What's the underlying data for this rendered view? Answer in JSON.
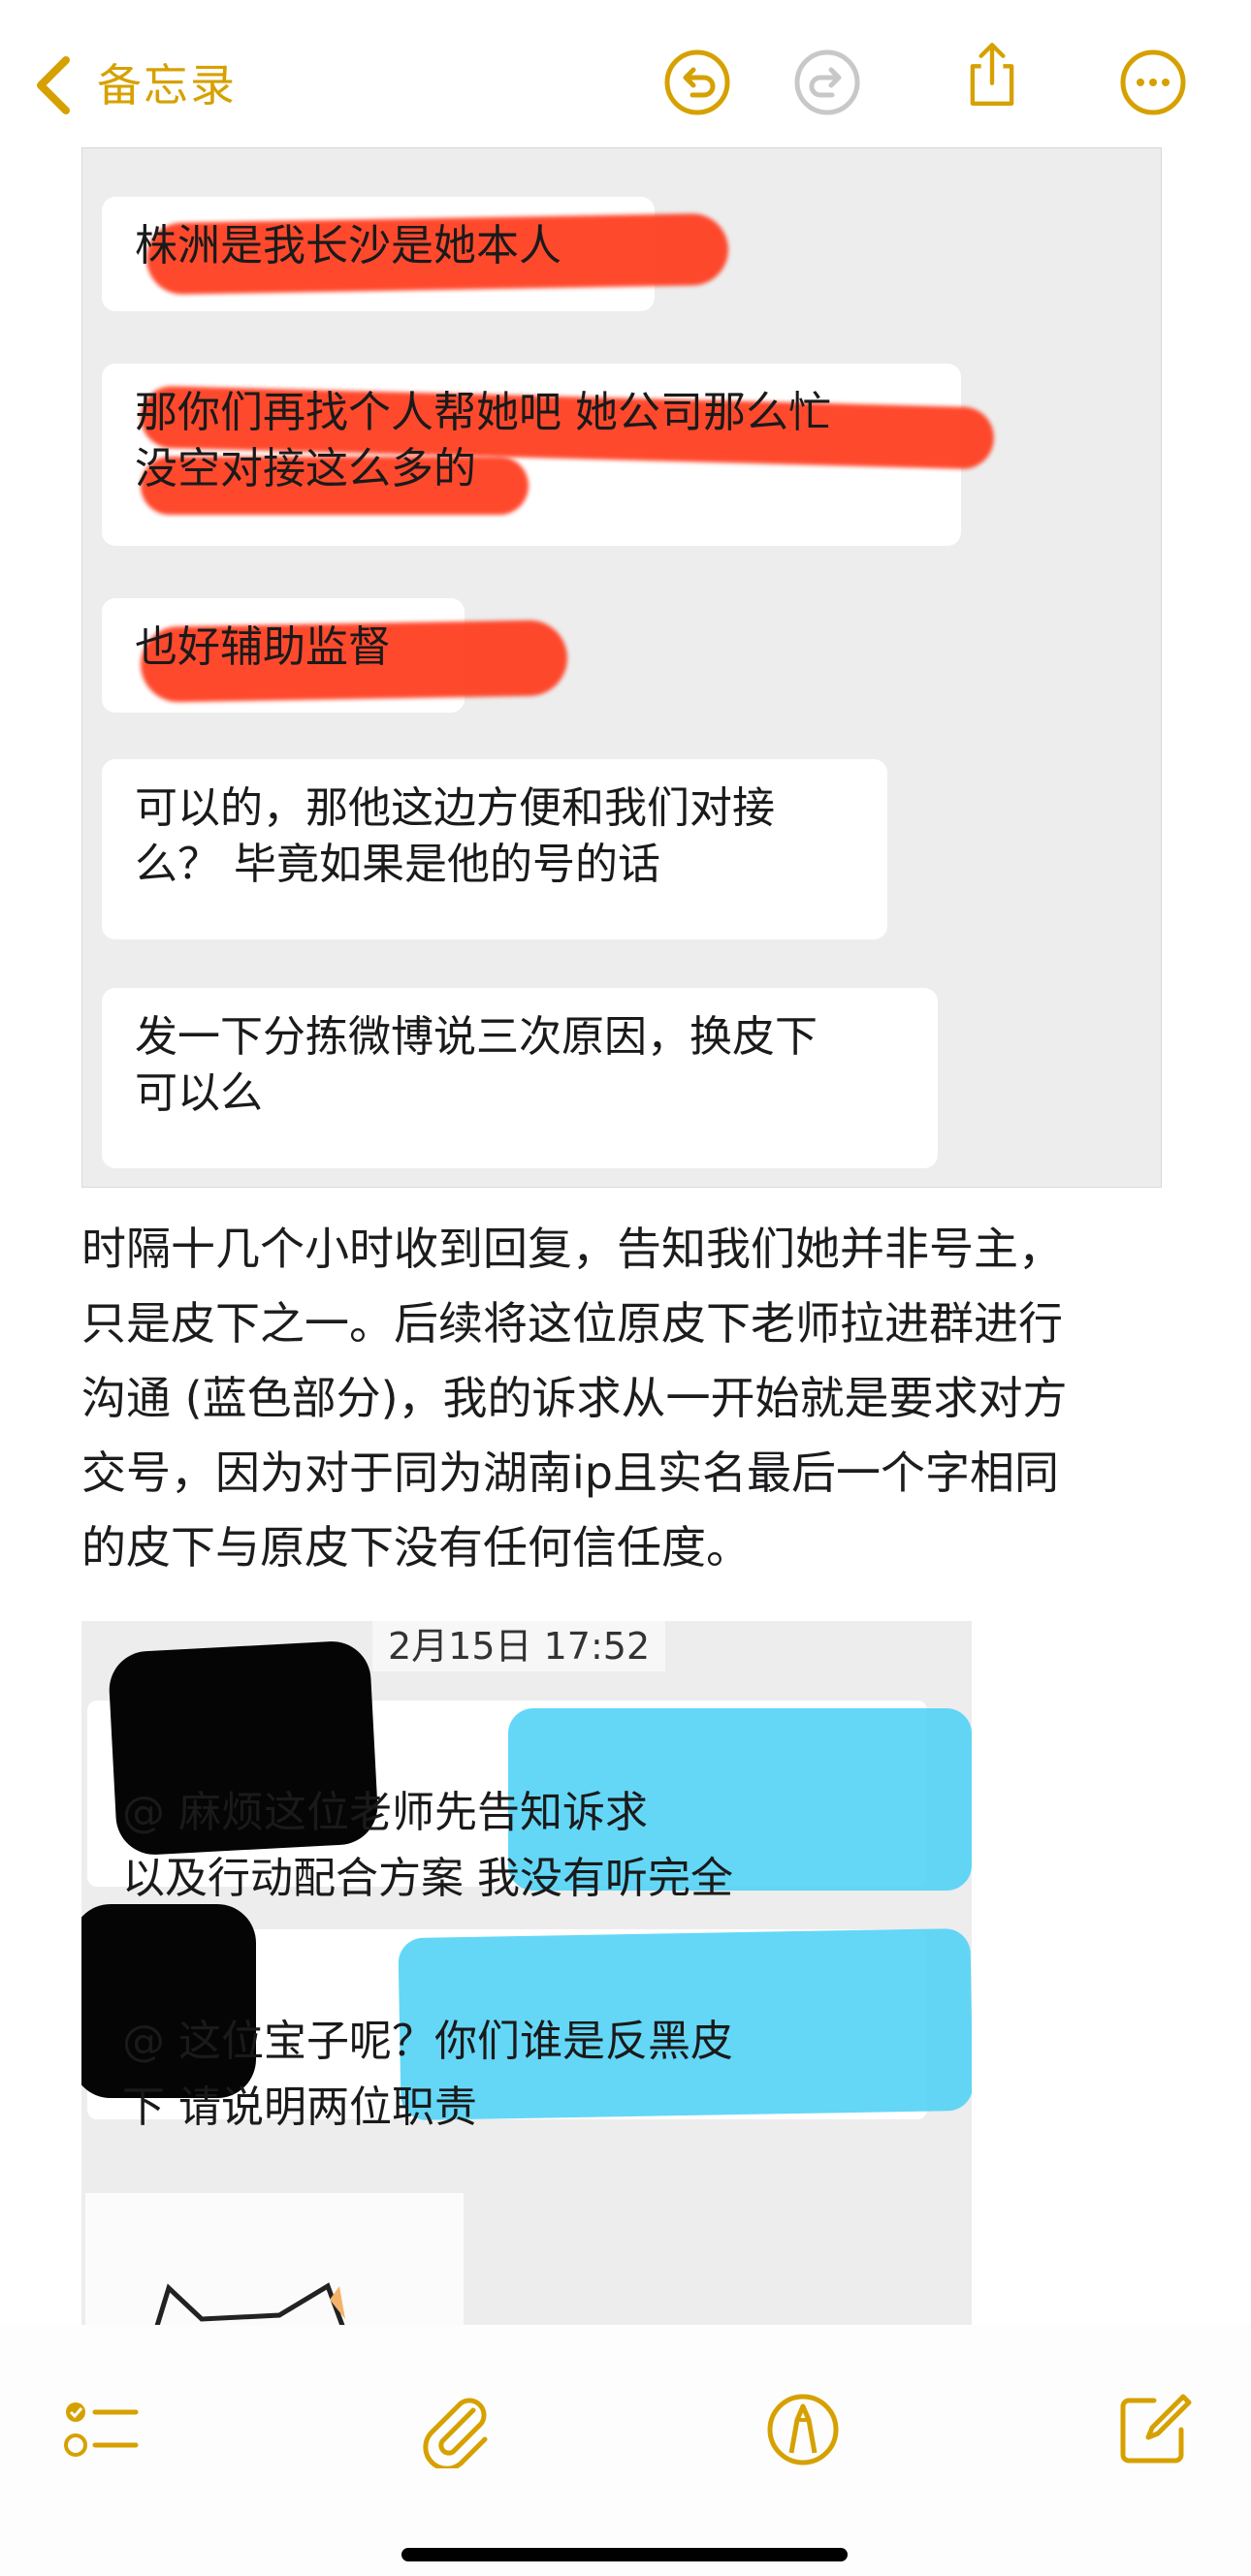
{
  "nav": {
    "back_label": "备忘录",
    "accent_color": "#d6a100",
    "icons": [
      "chevron-left-icon",
      "undo-icon",
      "redo-icon",
      "share-icon",
      "more-icon"
    ]
  },
  "chat1": {
    "messages": [
      "株洲是我长沙是她本人",
      "那你们再找个人帮她吧 她公司那么忙\n没空对接这么多的",
      "也好辅助监督",
      "可以的，那他这边方便和我们对接\n么？ 毕竟如果是他的号的话",
      "发一下分拣微博说三次原因，换皮下\n可以么"
    ],
    "highlight_color": "#ff3c1e"
  },
  "body": {
    "paragraph": "时隔十几个小时收到回复，告知我们她并非号主，\n只是皮下之一。后续将这位原皮下老师拉进群进行\n沟通 (蓝色部分)，我的诉求从一开始就是要求对方\n交号，因为对于同为湖南ip且实名最后一个字相同\n的皮下与原皮下没有任何信任度。"
  },
  "chat2": {
    "timestamp": "2月15日 17:52",
    "messages": [
      "@          麻烦这位老师先告知诉求\n以及行动配合方案 我没有听完全",
      "@    这位宝子呢？你们谁是反黑皮\n下 请说明两位职责"
    ],
    "highlight_color": "#4fd1f6"
  },
  "toolbar": {
    "icons": [
      "checklist-icon",
      "paperclip-icon",
      "markup-icon",
      "compose-icon"
    ]
  }
}
